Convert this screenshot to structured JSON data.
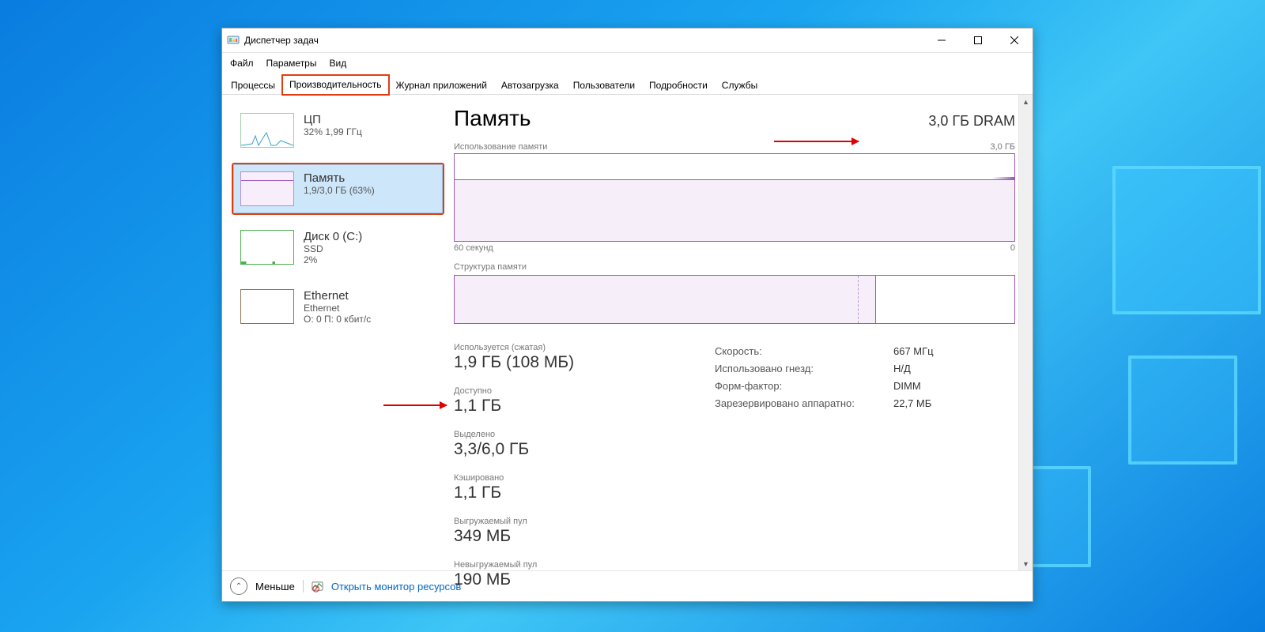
{
  "window": {
    "title": "Диспетчер задач"
  },
  "menu": {
    "file": "Файл",
    "options": "Параметры",
    "view": "Вид"
  },
  "tabs": {
    "processes": "Процессы",
    "performance": "Производительность",
    "app_history": "Журнал приложений",
    "startup": "Автозагрузка",
    "users": "Пользователи",
    "details": "Подробности",
    "services": "Службы"
  },
  "sidebar": {
    "cpu": {
      "title": "ЦП",
      "sub": "32%  1,99 ГГц"
    },
    "memory": {
      "title": "Память",
      "sub": "1,9/3,0 ГБ (63%)"
    },
    "disk": {
      "title": "Диск 0 (C:)",
      "sub": "SSD",
      "sub2": "2%"
    },
    "ethernet": {
      "title": "Ethernet",
      "sub": "Ethernet",
      "sub2": "О: 0  П: 0 кбит/с"
    }
  },
  "main": {
    "heading": "Память",
    "top_right": "3,0 ГБ DRAM",
    "usage_label": "Использование памяти",
    "usage_right": "3,0 ГБ",
    "axis_left": "60 секунд",
    "axis_right": "0",
    "struct_label": "Структура памяти",
    "metrics": {
      "used_k": "Используется (сжатая)",
      "used_v": "1,9 ГБ (108 МБ)",
      "avail_k": "Доступно",
      "avail_v": "1,1 ГБ",
      "commit_k": "Выделено",
      "commit_v": "3,3/6,0 ГБ",
      "cached_k": "Кэшировано",
      "cached_v": "1,1 ГБ",
      "pp_k": "Выгружаемый пул",
      "pp_v": "349 МБ",
      "npp_k": "Невыгружаемый пул",
      "npp_v": "190 МБ"
    },
    "spec": {
      "speed_k": "Скорость:",
      "speed_v": "667 МГц",
      "slots_k": "Использовано гнезд:",
      "slots_v": "Н/Д",
      "form_k": "Форм-фактор:",
      "form_v": "DIMM",
      "hw_k": "Зарезервировано аппаратно:",
      "hw_v": "22,7 МБ"
    }
  },
  "footer": {
    "less": "Меньше",
    "resmon": "Открыть монитор ресурсов"
  },
  "chart_data": {
    "type": "line",
    "title": "Использование памяти",
    "xlabel": "60 секунд",
    "ylabel": "ГБ",
    "ylim": [
      0,
      3.0
    ],
    "x": [
      60,
      55,
      50,
      45,
      40,
      35,
      30,
      25,
      20,
      15,
      10,
      5,
      0
    ],
    "values": [
      1.9,
      1.9,
      1.9,
      1.9,
      1.9,
      1.9,
      1.9,
      1.9,
      1.9,
      1.9,
      1.9,
      1.9,
      1.95
    ],
    "memory_composition": {
      "in_use_gb": 1.9,
      "modified_gb": 0.1,
      "standby_gb": 1.0,
      "free_gb": 0.0,
      "total_gb": 3.0
    }
  }
}
